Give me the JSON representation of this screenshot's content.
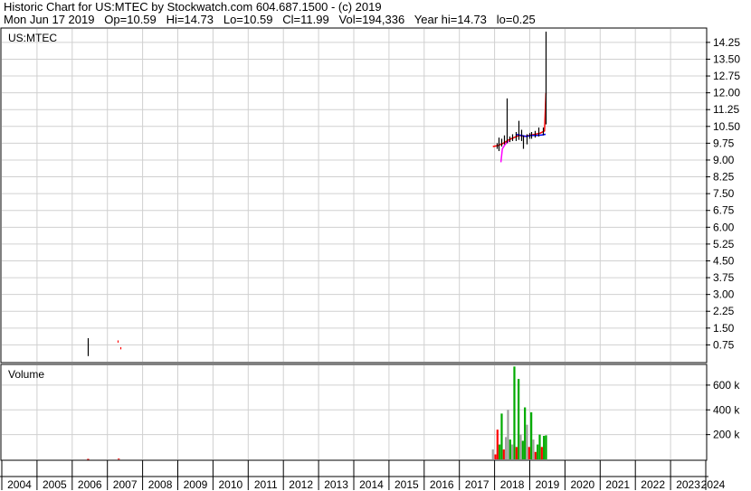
{
  "header": {
    "line1": "Historic Chart for US:MTEC by Stockwatch.com 604.687.1500 - (c) 2019",
    "line2": "Mon Jun 17 2019   Op=10.59   Hi=14.73   Lo=10.59   Cl=11.99   Vol=194,336   Year hi=14.73   lo=0.25"
  },
  "colors": {
    "grid": "#d0d0d0",
    "price_line": "#000000",
    "ma_short": "#ff0000",
    "ma_long": "#0000ff",
    "ma_mid": "#ff00ff",
    "volume_up": "#00aa00",
    "volume_down": "#ff0000",
    "volume_neutral": "#a0a0a0"
  },
  "chart_data": [
    {
      "type": "line",
      "label": "US:MTEC",
      "y_ticks": [
        "14.25",
        "13.50",
        "12.75",
        "12.00",
        "11.25",
        "10.50",
        "9.75",
        "9.00",
        "8.25",
        "7.50",
        "6.75",
        "6.00",
        "5.25",
        "4.50",
        "3.75",
        "3.00",
        "2.25",
        "1.50",
        "0.75"
      ],
      "ylim": [
        0.0,
        14.85
      ],
      "xlim": [
        2004.0,
        2024.0
      ],
      "grid": true,
      "price_bars": [
        {
          "x": 2006.45,
          "low": 0.25,
          "high": 1.05
        },
        {
          "x": 2007.3,
          "low": 0.85,
          "high": 0.95
        },
        {
          "x": 2007.38,
          "low": 0.55,
          "high": 0.65
        },
        {
          "x": 2018.05,
          "low": 9.5,
          "high": 9.75
        },
        {
          "x": 2018.12,
          "low": 9.4,
          "high": 10.0
        },
        {
          "x": 2018.2,
          "low": 9.6,
          "high": 9.95
        },
        {
          "x": 2018.28,
          "low": 9.7,
          "high": 10.1
        },
        {
          "x": 2018.35,
          "low": 9.75,
          "high": 11.75
        },
        {
          "x": 2018.42,
          "low": 9.8,
          "high": 10.05
        },
        {
          "x": 2018.5,
          "low": 9.85,
          "high": 10.15
        },
        {
          "x": 2018.6,
          "low": 9.85,
          "high": 10.25
        },
        {
          "x": 2018.68,
          "low": 9.9,
          "high": 10.75
        },
        {
          "x": 2018.75,
          "low": 9.85,
          "high": 10.35
        },
        {
          "x": 2018.82,
          "low": 9.5,
          "high": 10.1
        },
        {
          "x": 2018.9,
          "low": 9.7,
          "high": 10.15
        },
        {
          "x": 2018.98,
          "low": 9.95,
          "high": 10.2
        },
        {
          "x": 2019.05,
          "low": 9.95,
          "high": 10.25
        },
        {
          "x": 2019.15,
          "low": 10.0,
          "high": 10.3
        },
        {
          "x": 2019.25,
          "low": 10.05,
          "high": 10.45
        },
        {
          "x": 2019.38,
          "low": 10.1,
          "high": 10.45
        },
        {
          "x": 2019.46,
          "low": 10.59,
          "high": 14.73
        }
      ],
      "series": [
        {
          "color_key": "ma_short",
          "x": [
            2017.95,
            2018.1,
            2018.25,
            2018.4,
            2018.55,
            2018.7,
            2018.85,
            2019.0,
            2019.15,
            2019.3,
            2019.42,
            2019.46
          ],
          "y": [
            9.6,
            9.65,
            9.75,
            9.9,
            10.0,
            10.1,
            10.05,
            10.1,
            10.15,
            10.2,
            10.3,
            11.99
          ]
        },
        {
          "color_key": "ma_long",
          "x": [
            2018.6,
            2018.75,
            2018.9,
            2019.05,
            2019.2,
            2019.35,
            2019.45
          ],
          "y": [
            10.15,
            10.1,
            10.05,
            10.1,
            10.1,
            10.12,
            10.15
          ]
        },
        {
          "color_key": "ma_mid",
          "x": [
            2018.18,
            2018.22,
            2018.3,
            2018.4
          ],
          "y": [
            8.9,
            9.5,
            9.7,
            9.85
          ]
        }
      ]
    },
    {
      "type": "bar",
      "label": "Volume",
      "y_ticks": [
        "600 k",
        "400 k",
        "200 k"
      ],
      "ylim": [
        0,
        760000
      ],
      "grid": true,
      "bars": [
        {
          "x": 2006.45,
          "v": 4000,
          "dir": "down"
        },
        {
          "x": 2007.32,
          "v": 6000,
          "dir": "down"
        },
        {
          "x": 2017.95,
          "v": 80000,
          "dir": "neutral"
        },
        {
          "x": 2018.02,
          "v": 40000,
          "dir": "down"
        },
        {
          "x": 2018.08,
          "v": 240000,
          "dir": "down"
        },
        {
          "x": 2018.14,
          "v": 120000,
          "dir": "up"
        },
        {
          "x": 2018.2,
          "v": 370000,
          "dir": "up"
        },
        {
          "x": 2018.26,
          "v": 80000,
          "dir": "down"
        },
        {
          "x": 2018.32,
          "v": 180000,
          "dir": "neutral"
        },
        {
          "x": 2018.38,
          "v": 400000,
          "dir": "neutral"
        },
        {
          "x": 2018.44,
          "v": 160000,
          "dir": "up"
        },
        {
          "x": 2018.5,
          "v": 120000,
          "dir": "neutral"
        },
        {
          "x": 2018.56,
          "v": 750000,
          "dir": "up"
        },
        {
          "x": 2018.62,
          "v": 100000,
          "dir": "down"
        },
        {
          "x": 2018.68,
          "v": 650000,
          "dir": "up"
        },
        {
          "x": 2018.74,
          "v": 200000,
          "dir": "neutral"
        },
        {
          "x": 2018.8,
          "v": 150000,
          "dir": "up"
        },
        {
          "x": 2018.86,
          "v": 420000,
          "dir": "up"
        },
        {
          "x": 2018.92,
          "v": 280000,
          "dir": "neutral"
        },
        {
          "x": 2018.98,
          "v": 100000,
          "dir": "down"
        },
        {
          "x": 2019.04,
          "v": 380000,
          "dir": "up"
        },
        {
          "x": 2019.1,
          "v": 160000,
          "dir": "neutral"
        },
        {
          "x": 2019.16,
          "v": 60000,
          "dir": "down"
        },
        {
          "x": 2019.22,
          "v": 120000,
          "dir": "up"
        },
        {
          "x": 2019.28,
          "v": 200000,
          "dir": "up"
        },
        {
          "x": 2019.34,
          "v": 100000,
          "dir": "down"
        },
        {
          "x": 2019.4,
          "v": 190000,
          "dir": "up"
        },
        {
          "x": 2019.46,
          "v": 194336,
          "dir": "up"
        }
      ]
    }
  ],
  "x_ticks": [
    "2004",
    "2005",
    "2006",
    "2007",
    "2008",
    "2009",
    "2010",
    "2011",
    "2012",
    "2013",
    "2014",
    "2015",
    "2016",
    "2017",
    "2018",
    "2019",
    "2020",
    "2021",
    "2022",
    "2023",
    "2024"
  ]
}
